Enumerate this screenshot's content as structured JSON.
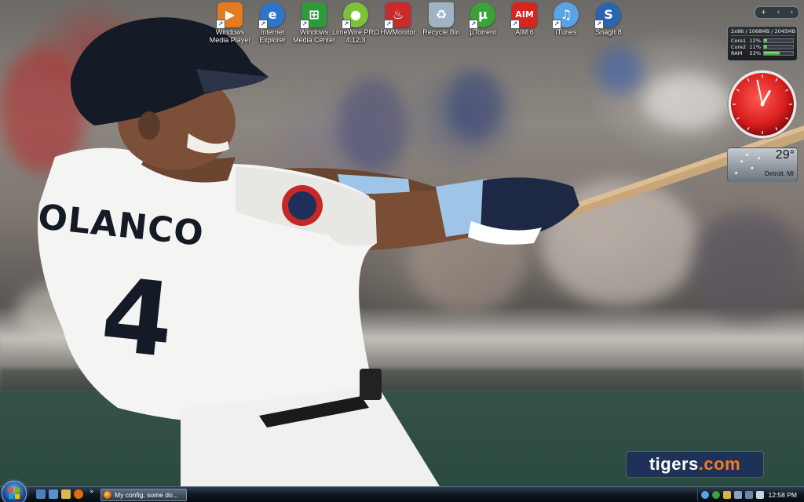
{
  "desktop_icons": [
    {
      "label": "Windows Media Player",
      "icon": "windows-media-player-icon",
      "color": "#e57a1e"
    },
    {
      "label": "Internet Explorer",
      "icon": "internet-explorer-icon",
      "color": "#2e74c9"
    },
    {
      "label": "Windows Media Center",
      "icon": "windows-media-center-icon",
      "color": "#2f9a3c"
    },
    {
      "label": "LimeWire PRO 4.12.3",
      "icon": "limewire-icon",
      "color": "#7ec23a"
    },
    {
      "label": "HWMonitor",
      "icon": "hwmonitor-icon",
      "color": "#c92a2a"
    },
    {
      "label": "Recycle Bin",
      "icon": "recycle-bin-icon",
      "color": "#9fb3c4"
    },
    {
      "label": "µTorrent",
      "icon": "utorrent-icon",
      "color": "#3aa335"
    },
    {
      "label": "AIM 6",
      "icon": "aim-icon",
      "color": "#d8261f"
    },
    {
      "label": "iTunes",
      "icon": "itunes-icon",
      "color": "#5aa3e6"
    },
    {
      "label": "SnagIt 8",
      "icon": "snagit-icon",
      "color": "#2a64b4"
    }
  ],
  "icon_glyphs": [
    "▶",
    "e",
    "⊞",
    "●",
    "♨",
    "♻",
    "µ",
    "AIM",
    "♫",
    "S"
  ],
  "sidebar": {
    "controls": [
      "+",
      "‹",
      "›"
    ],
    "hwmonitor": {
      "memory": "2x86 / 1068MB / 2045MB",
      "rows": [
        {
          "name": "Core1",
          "value": "12%",
          "level": 12
        },
        {
          "name": "Core2",
          "value": "11%",
          "level": 11
        },
        {
          "name": "RAM",
          "value": "53%",
          "level": 53
        }
      ]
    },
    "clock": {
      "hour": 12,
      "minute": 58
    },
    "weather": {
      "temperature": "29°",
      "city": "Detroit, MI"
    }
  },
  "wallpaper": {
    "jersey_name": "OLANCO",
    "jersey_number": "4",
    "watermark_main": "tigers",
    "watermark_tld": ".com"
  },
  "taskbar": {
    "quick_launch": [
      {
        "icon": "show-desktop-icon",
        "color": "#4d7fc0"
      },
      {
        "icon": "switch-windows-icon",
        "color": "#5c8fd0"
      },
      {
        "icon": "folder-icon",
        "color": "#e0b64a"
      },
      {
        "icon": "firefox-icon",
        "color": "#e06b10"
      }
    ],
    "overflow": "»",
    "task_title": "My config, some do...",
    "tray_icons": [
      {
        "icon": "network-icon",
        "color": "#5aa3e6"
      },
      {
        "icon": "utorrent-tray-icon",
        "color": "#3aa335"
      },
      {
        "icon": "security-icon",
        "color": "#d9b43a"
      },
      {
        "icon": "monitor-tray-icon",
        "color": "#8aa2bd"
      },
      {
        "icon": "display-icon",
        "color": "#6b86a8"
      },
      {
        "icon": "volume-icon",
        "color": "#c9d3dd"
      }
    ],
    "clock": "12:58 PM"
  }
}
